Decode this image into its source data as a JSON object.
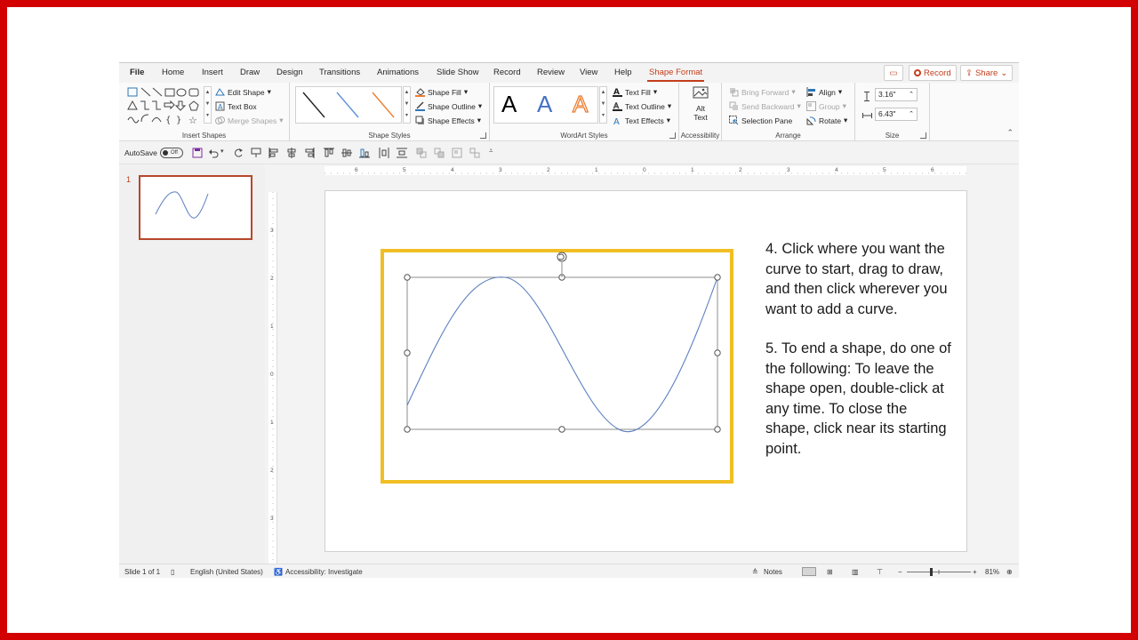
{
  "tabs": [
    {
      "label": "File"
    },
    {
      "label": "Home"
    },
    {
      "label": "Insert"
    },
    {
      "label": "Draw"
    },
    {
      "label": "Design"
    },
    {
      "label": "Transitions"
    },
    {
      "label": "Animations"
    },
    {
      "label": "Slide Show"
    },
    {
      "label": "Record"
    },
    {
      "label": "Review"
    },
    {
      "label": "View"
    },
    {
      "label": "Help"
    },
    {
      "label": "Shape Format"
    }
  ],
  "top_actions": {
    "record": "Record",
    "share": "Share"
  },
  "ribbon": {
    "insert_shapes": {
      "label": "Insert Shapes",
      "edit_shape": "Edit Shape",
      "text_box": "Text Box",
      "merge_shapes": "Merge Shapes",
      "glyphs": "▣╲╲□○▭\n△⌐⌐⇨⇩⬠\n↝╮╮{}☆"
    },
    "shape_styles": {
      "label": "Shape Styles",
      "shape_fill": "Shape Fill",
      "shape_outline": "Shape Outline",
      "shape_effects": "Shape Effects",
      "line_colors": [
        "#1f1f1f",
        "#5b8fd6",
        "#ed7d31"
      ]
    },
    "wordart_styles": {
      "label": "WordArt Styles",
      "letters": [
        "A",
        "A",
        "A"
      ],
      "text_fill": "Text Fill",
      "text_outline": "Text Outline",
      "text_effects": "Text Effects"
    },
    "accessibility": {
      "label": "Accessibility",
      "alt_text_1": "Alt",
      "alt_text_2": "Text"
    },
    "arrange": {
      "label": "Arrange",
      "bring_forward": "Bring Forward",
      "send_backward": "Send Backward",
      "selection_pane": "Selection Pane",
      "align": "Align",
      "group": "Group",
      "rotate": "Rotate"
    },
    "size": {
      "label": "Size",
      "height": "3.16\"",
      "width": "6.43\""
    }
  },
  "qat": {
    "autosave": "AutoSave",
    "toggle": "Off"
  },
  "thumbnails": {
    "slide_number": "1"
  },
  "rulers": {
    "horizontal": [
      "6",
      "5",
      "4",
      "3",
      "2",
      "1",
      "0",
      "1",
      "2",
      "3",
      "4",
      "5",
      "6"
    ],
    "vertical": [
      "3",
      "2",
      "1",
      "0",
      "1",
      "2",
      "3"
    ]
  },
  "slide": {
    "paragraph_1": "4. Click where you want the curve to start, drag to draw, and then click wherever you want to add a curve.",
    "paragraph_2": "5. To end a shape, do one of the following: To leave the shape open, double-click at any time. To close the shape, click near its starting point."
  },
  "status": {
    "slide_of": "Slide 1 of 1",
    "language": "English (United States)",
    "accessibility": "Accessibility: Investigate",
    "notes": "Notes",
    "zoom": "81%"
  },
  "colors": {
    "accent": "#c43e1c",
    "frame": "#d20000",
    "highlight": "#f1be24",
    "curve": "#5b7fc0"
  }
}
